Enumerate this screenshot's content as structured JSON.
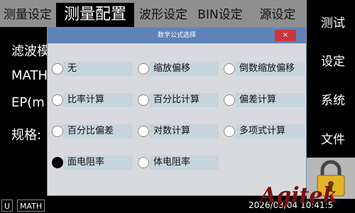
{
  "tabs": [
    {
      "label": "测量设定"
    },
    {
      "label": "测量配置"
    },
    {
      "label": "波形设定"
    },
    {
      "label": "BIN设定"
    },
    {
      "label": "源设定"
    }
  ],
  "sidebar": {
    "items": [
      {
        "label": "测试"
      },
      {
        "label": "设定"
      },
      {
        "label": "系统"
      },
      {
        "label": "文件"
      }
    ]
  },
  "background_labels": [
    "滤波模",
    "MATH",
    "EP(m",
    "规格:"
  ],
  "dialog": {
    "title": "数学公式选择",
    "close_label": "×",
    "options": [
      {
        "label": "无",
        "selected": false
      },
      {
        "label": "缩放偏移",
        "selected": false
      },
      {
        "label": "倒数缩放偏移",
        "selected": false
      },
      {
        "label": "比率计算",
        "selected": false
      },
      {
        "label": "百分比计算",
        "selected": false
      },
      {
        "label": "偏差计算",
        "selected": false
      },
      {
        "label": "百分比偏差",
        "selected": false
      },
      {
        "label": "对数计算",
        "selected": false
      },
      {
        "label": "多项式计算",
        "selected": false
      },
      {
        "label": "面电阻率",
        "selected": true
      },
      {
        "label": "体电阻率",
        "selected": false
      }
    ]
  },
  "status": {
    "u_label": "U",
    "math_label": "MATH",
    "datetime": "2026/03/04 10:41:5"
  },
  "brand": "Agitek",
  "icons": {
    "lock": "padlock-icon",
    "close": "close-icon"
  },
  "colors": {
    "titlebar": "#5f82b8",
    "close": "#c9373d",
    "option_bg": "#c6d4dc"
  }
}
